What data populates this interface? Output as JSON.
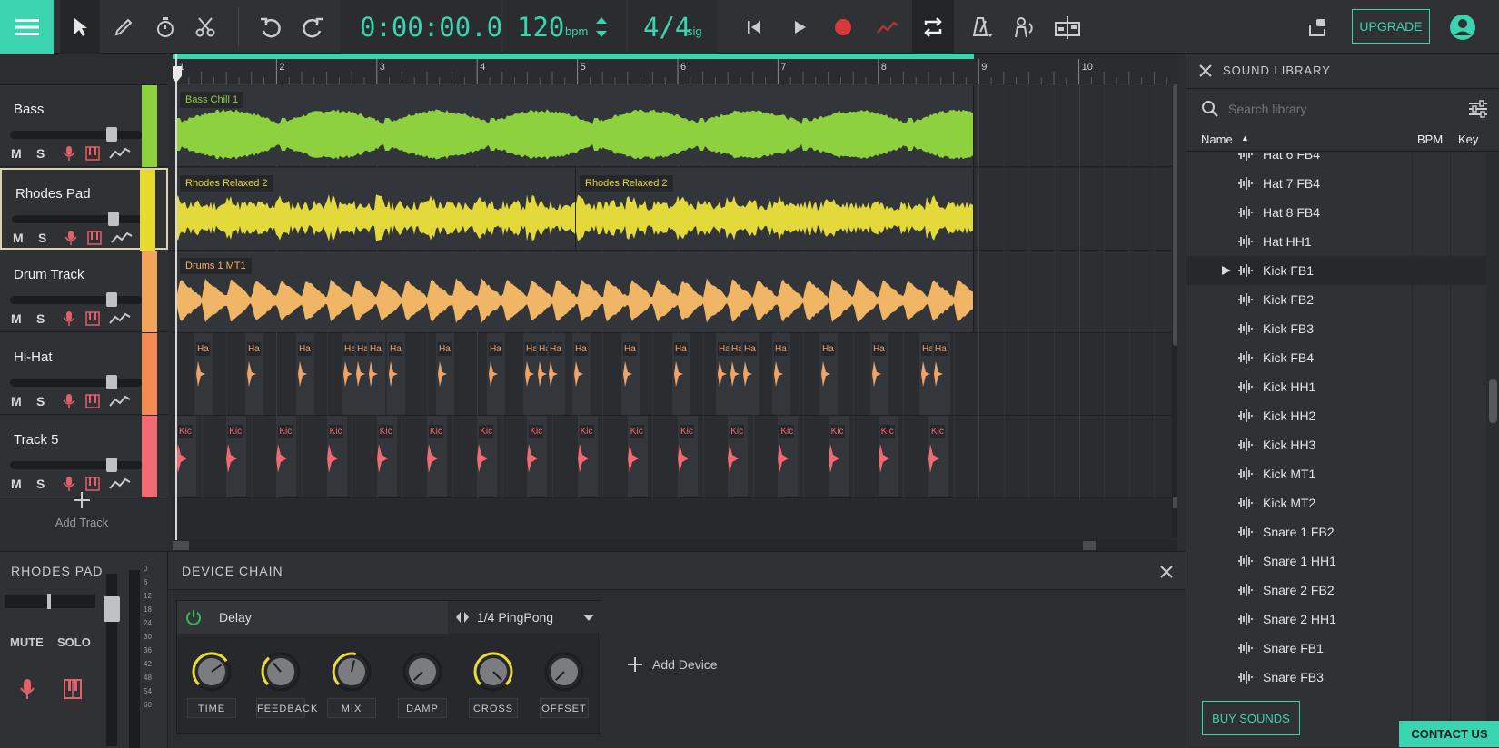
{
  "toolbar": {
    "time": "0:00:00.00",
    "bpm_value": "120",
    "bpm_unit": "bpm",
    "signature": "4/4",
    "signature_unit": "sig",
    "upgrade_label": "UPGRADE"
  },
  "ruler": {
    "bars": [
      "1",
      "2",
      "3",
      "4",
      "5",
      "6",
      "7",
      "8",
      "9",
      "10",
      "1"
    ]
  },
  "tracks": [
    {
      "name": "Bass",
      "color": "#8dd13f"
    },
    {
      "name": "Rhodes Pad",
      "color": "#e8d92f"
    },
    {
      "name": "Drum Track",
      "color": "#f0a55a"
    },
    {
      "name": "Hi-Hat",
      "color": "#f48b52"
    },
    {
      "name": "Track 5",
      "color": "#ef6a72"
    }
  ],
  "track_controls": {
    "mute": "M",
    "solo": "S"
  },
  "add_track_label": "Add Track",
  "clips": {
    "bass": "Bass Chill 1",
    "rhodes_a": "Rhodes Relaxed 2",
    "rhodes_b": "Rhodes Relaxed 2",
    "drums": "Drums 1 MT1",
    "hihat_short": "Ha",
    "kick_short": "Kic"
  },
  "library": {
    "title": "SOUND LIBRARY",
    "search_placeholder": "Search library",
    "col_name": "Name",
    "col_bpm": "BPM",
    "col_key": "Key",
    "items": [
      "Hat 6 FB4",
      "Hat 7 FB4",
      "Hat 8 FB4",
      "Hat HH1",
      "Kick FB1",
      "Kick FB2",
      "Kick FB3",
      "Kick FB4",
      "Kick HH1",
      "Kick HH2",
      "Kick HH3",
      "Kick MT1",
      "Kick MT2",
      "Snare 1 FB2",
      "Snare 1 HH1",
      "Snare 2 FB2",
      "Snare 2 HH1",
      "Snare FB1",
      "Snare FB3"
    ],
    "buy_label": "BUY SOUNDS",
    "contact_label": "CONTACT US"
  },
  "bottom": {
    "track_title": "RHODES PAD",
    "mute_label": "MUTE",
    "solo_label": "SOLO",
    "meter_marks": [
      "0",
      "6",
      "12",
      "18",
      "24",
      "30",
      "36",
      "42",
      "48",
      "54",
      "60"
    ],
    "device_chain_title": "DEVICE CHAIN",
    "device_name": "Delay",
    "preset": "1/4 PingPong",
    "add_device": "Add Device",
    "knobs": [
      {
        "label": "TIME",
        "level": 0.7
      },
      {
        "label": "FEEDBACK",
        "level": 0.35
      },
      {
        "label": "MIX",
        "level": 0.55
      },
      {
        "label": "DAMP",
        "level": 0.0
      },
      {
        "label": "CROSS",
        "level": 1.0
      },
      {
        "label": "OFFSET",
        "level": 0.0
      }
    ]
  },
  "colors": {
    "accent": "#3ad4b0",
    "record": "#d9393c"
  }
}
